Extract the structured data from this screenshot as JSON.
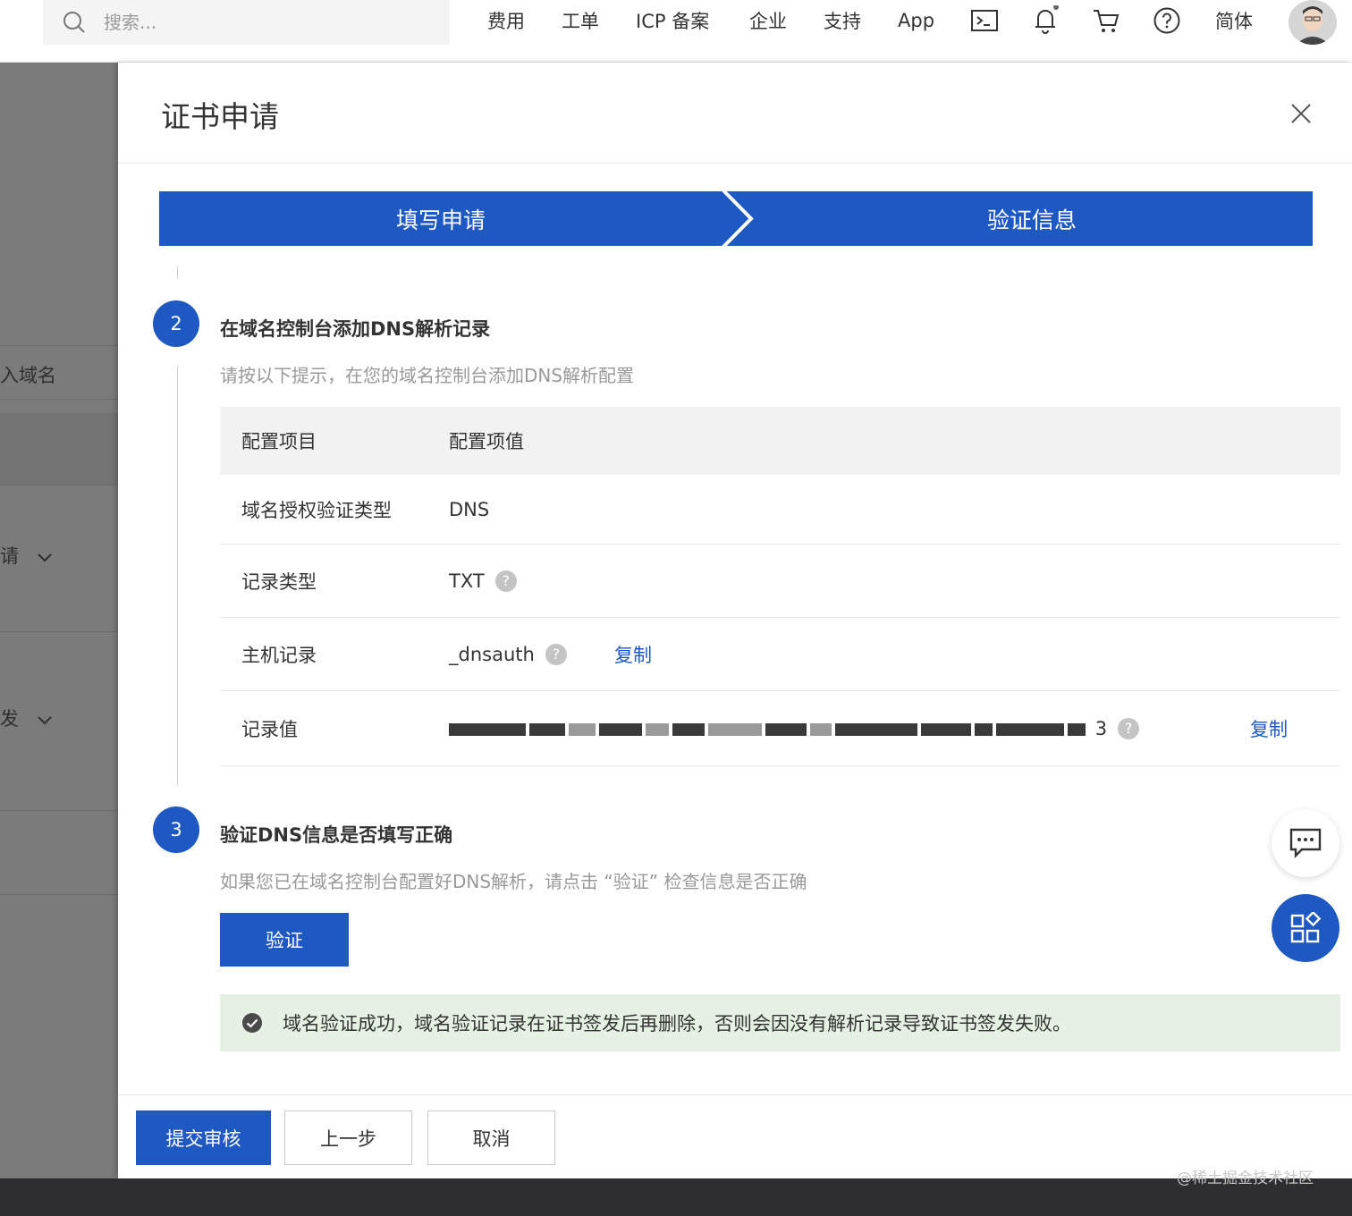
{
  "topbar": {
    "search_placeholder": "搜索...",
    "nav": [
      "费用",
      "工单",
      "ICP 备案",
      "企业",
      "支持",
      "App"
    ],
    "language": "简体",
    "icons": [
      "terminal-icon",
      "bell-icon",
      "cart-icon",
      "help-icon"
    ]
  },
  "sidebar": {
    "items": [
      "入域名",
      "请",
      "发"
    ]
  },
  "drawer": {
    "title": "证书申请",
    "steps": [
      "填写申请",
      "验证信息"
    ],
    "section2": {
      "number": "2",
      "title": "在域名控制台添加DNS解析记录",
      "desc": "请按以下提示，在您的域名控制台添加DNS解析配置"
    },
    "table": {
      "headers": [
        "配置项目",
        "配置项值"
      ],
      "rows": [
        {
          "key": "域名授权验证类型",
          "value": "DNS"
        },
        {
          "key": "记录类型",
          "value": "TXT"
        },
        {
          "key": "主机记录",
          "value": "_dnsauth",
          "action": "复制"
        },
        {
          "key": "记录值",
          "value_suffix": "3",
          "action": "复制"
        }
      ]
    },
    "section3": {
      "number": "3",
      "title": "验证DNS信息是否填写正确",
      "desc": "如果您已在域名控制台配置好DNS解析，请点击 “验证” 检查信息是否正确"
    },
    "verify_label": "验证",
    "success_message": "域名验证成功，域名验证记录在证书签发后再删除，否则会因没有解析记录导致证书签发失败。",
    "footer": {
      "submit": "提交审核",
      "prev": "上一步",
      "cancel": "取消"
    }
  },
  "watermark": "@稀土掘金技术社区",
  "colors": {
    "primary": "#1e59c3",
    "success_bg": "#e5f1e3",
    "overlay_gray": "#7b7b7b"
  }
}
